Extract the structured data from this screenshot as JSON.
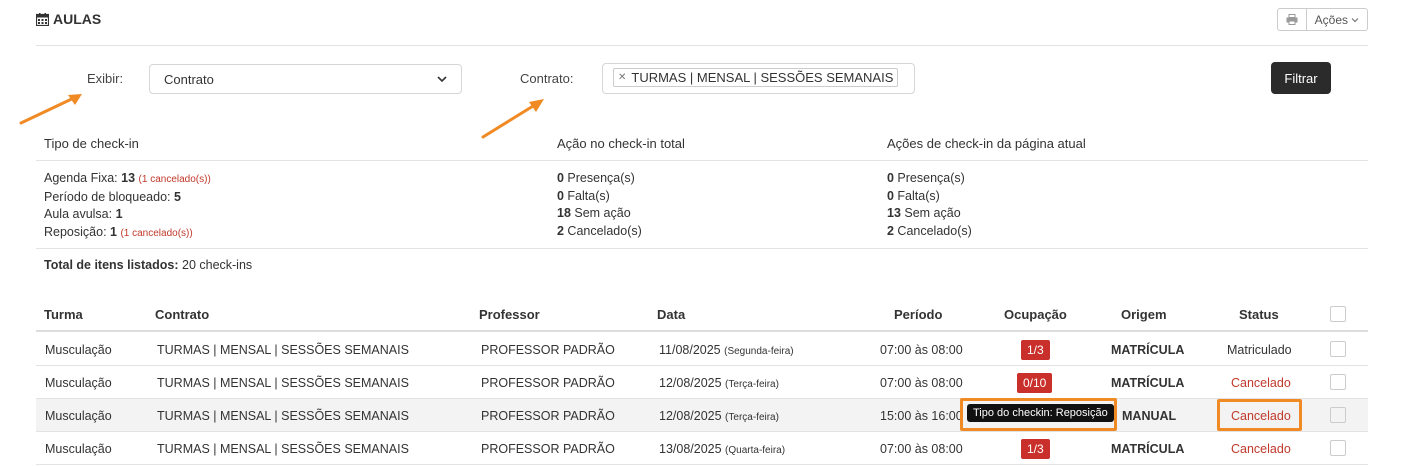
{
  "header": {
    "title": "AULAS",
    "actions_label": "Ações"
  },
  "filters": {
    "exibir_label": "Exibir:",
    "exibir_value": "Contrato",
    "contrato_label": "Contrato:",
    "contrato_tag": "TURMAS | MENSAL | SESSÕES SEMANAIS",
    "filter_button": "Filtrar"
  },
  "summary": {
    "tipo": {
      "title": "Tipo de check-in",
      "agenda_label": "Agenda Fixa: ",
      "agenda_value": "13",
      "agenda_note": "(1 cancelado(s))",
      "periodo_label": "Período de bloqueado: ",
      "periodo_value": "5",
      "avulsa_label": "Aula avulsa: ",
      "avulsa_value": "1",
      "reposicao_label": "Reposição: ",
      "reposicao_value": "1",
      "reposicao_note": "(1 cancelado(s))"
    },
    "acao_total": {
      "title": "Ação no check-in total",
      "presenca_value": "0",
      "presenca_label": " Presença(s)",
      "falta_value": "0",
      "falta_label": " Falta(s)",
      "sem_value": "18",
      "sem_label": " Sem ação",
      "cancelado_value": "2",
      "cancelado_label": " Cancelado(s)"
    },
    "acao_pagina": {
      "title": "Ações de check-in da página atual",
      "presenca_value": "0",
      "presenca_label": " Presença(s)",
      "falta_value": "0",
      "falta_label": " Falta(s)",
      "sem_value": "13",
      "sem_label": " Sem ação",
      "cancelado_value": "2",
      "cancelado_label": " Cancelado(s)"
    },
    "total_label": "Total de itens listados:",
    "total_value": " 20 check-ins"
  },
  "table": {
    "columns": [
      "Turma",
      "Contrato",
      "Professor",
      "Data",
      "Período",
      "Ocupação",
      "Origem",
      "Status"
    ],
    "rows": [
      {
        "turma": "Musculação",
        "contrato": "TURMAS | MENSAL | SESSÕES SEMANAIS",
        "professor": "PROFESSOR PADRÃO",
        "data": "11/08/2025",
        "dia": "(Segunda-feira)",
        "periodo": "07:00 às 08:00",
        "ocupacao": "1/3",
        "origem": "MATRÍCULA",
        "status": "Matriculado"
      },
      {
        "turma": "Musculação",
        "contrato": "TURMAS | MENSAL | SESSÕES SEMANAIS",
        "professor": "PROFESSOR PADRÃO",
        "data": "12/08/2025",
        "dia": "(Terça-feira)",
        "periodo": "07:00 às 08:00",
        "ocupacao": "0/10",
        "origem": "MATRÍCULA",
        "status": "Cancelado"
      },
      {
        "turma": "Musculação",
        "contrato": "TURMAS | MENSAL | SESSÕES SEMANAIS",
        "professor": "PROFESSOR PADRÃO",
        "data": "12/08/2025",
        "dia": "(Terça-feira)",
        "periodo": "15:00 às 16:00",
        "ocupacao": "",
        "origem": "MANUAL",
        "status": "Cancelado"
      },
      {
        "turma": "Musculação",
        "contrato": "TURMAS | MENSAL | SESSÕES SEMANAIS",
        "professor": "PROFESSOR PADRÃO",
        "data": "13/08/2025",
        "dia": "(Quarta-feira)",
        "periodo": "07:00 às 08:00",
        "ocupacao": "1/3",
        "origem": "MATRÍCULA",
        "status": "Cancelado"
      }
    ],
    "tooltip": "Tipo do checkin: Reposição"
  },
  "colors": {
    "accent_orange": "#f08a24",
    "danger": "#c9302c",
    "dark_button": "#2b2b2b"
  }
}
